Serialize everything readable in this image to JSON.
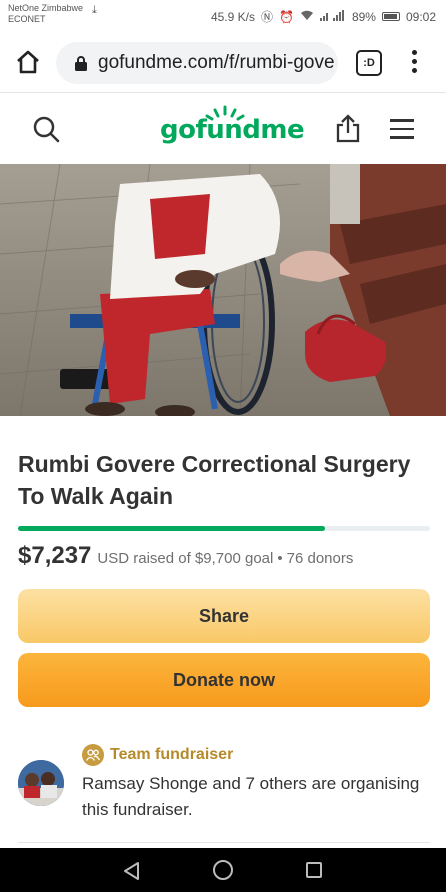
{
  "status_bar": {
    "carrier_line1": "NetOne Zimbabwe",
    "carrier_line2": "ECONET",
    "speed": "45.9 K/s",
    "battery": "89%",
    "time": "09:02"
  },
  "browser": {
    "url": "gofundme.com/f/rumbi-gove",
    "tabs_label": ":D"
  },
  "site": {
    "logo_text": "gofundme"
  },
  "campaign": {
    "title": "Rumbi Govere Correctional Surgery To Walk Again",
    "raised_amount": "$7,237",
    "raised_text": "USD raised of $9,700 goal",
    "donors_text": "76 donors",
    "progress_fraction": 0.746
  },
  "buttons": {
    "share": "Share",
    "donate": "Donate now"
  },
  "organiser": {
    "team_label": "Team fundraiser",
    "text": "Ramsay Shonge and 7 others are organising this fundraiser."
  },
  "colors": {
    "brand_green": "#02a95c",
    "share_button": "#f9c867",
    "donate_button": "#f79a1c",
    "team_gold": "#b58a2b"
  }
}
